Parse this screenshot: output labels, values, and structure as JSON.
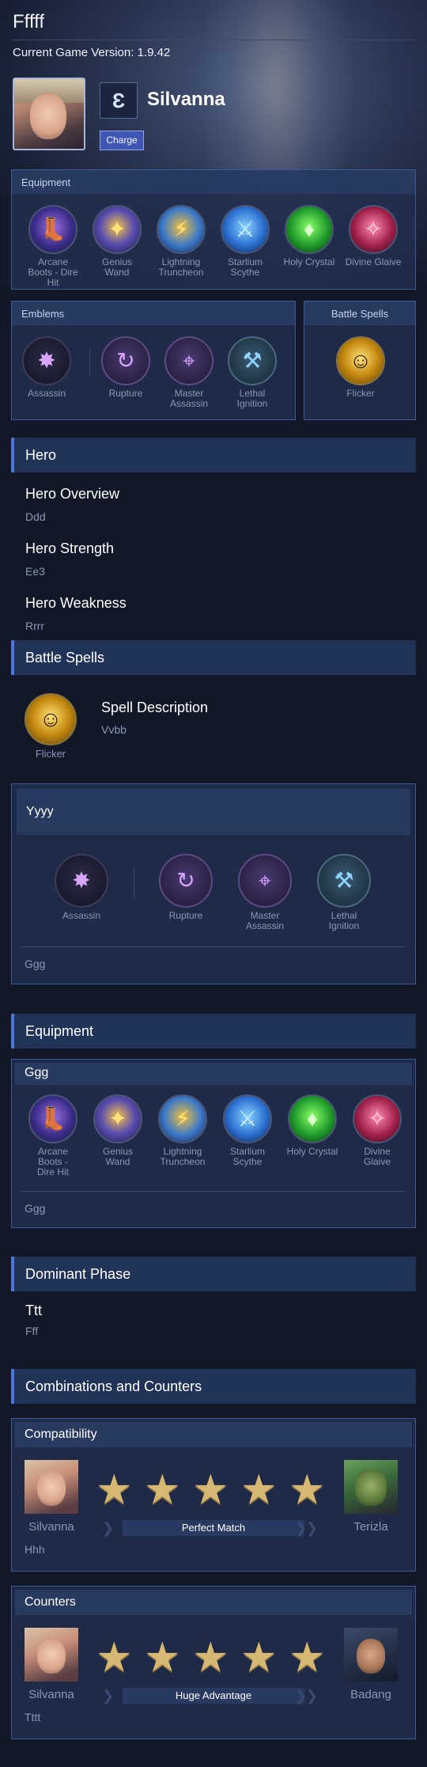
{
  "page": {
    "title": "Fffff",
    "version": "Current Game Version: 1.9.42"
  },
  "hero": {
    "name": "Silvanna",
    "role_badge": "Charge",
    "role_icon": "charge-role-icon"
  },
  "build": {
    "equipment": {
      "header": "Equipment",
      "items": [
        {
          "label": "Arcane Boots - Dire Hit",
          "icon": "arcane-boots-icon"
        },
        {
          "label": "Genius Wand",
          "icon": "genius-wand-icon"
        },
        {
          "label": "Lightning Truncheon",
          "icon": "lightning-truncheon-icon"
        },
        {
          "label": "Starlium Scythe",
          "icon": "starlium-scythe-icon"
        },
        {
          "label": "Holy Crystal",
          "icon": "holy-crystal-icon"
        },
        {
          "label": "Divine Glaive",
          "icon": "divine-glaive-icon"
        }
      ]
    },
    "emblems": {
      "header": "Emblems",
      "items": [
        {
          "label": "Assassin",
          "icon": "assassin-emblem-icon"
        },
        {
          "label": "Rupture",
          "icon": "rupture-talent-icon"
        },
        {
          "label": "Master Assassin",
          "icon": "master-assassin-talent-icon"
        },
        {
          "label": "Lethal Ignition",
          "icon": "lethal-ignition-talent-icon"
        }
      ]
    },
    "battle_spells": {
      "header": "Battle Spells",
      "items": [
        {
          "label": "Flicker",
          "icon": "flicker-spell-icon"
        }
      ]
    }
  },
  "hero_section": {
    "header": "Hero",
    "overview_title": "Hero Overview",
    "overview_text": "Ddd",
    "strength_title": "Hero Strength",
    "strength_text": "Ee3",
    "weakness_title": "Hero Weakness",
    "weakness_text": "Rrrr"
  },
  "spells_section": {
    "header": "Battle Spells",
    "spell_label": "Flicker",
    "description_title": "Spell Description",
    "description_text": "Vvbb"
  },
  "emblem_section": {
    "header": "Yyyy",
    "items": [
      {
        "label": "Assassin"
      },
      {
        "label": "Rupture"
      },
      {
        "label": "Master Assassin"
      },
      {
        "label": "Lethal Ignition"
      }
    ],
    "note": "Ggg"
  },
  "equipment_section": {
    "header": "Equipment",
    "build_title": "Ggg",
    "items": [
      {
        "label": "Arcane Boots - Dire Hit"
      },
      {
        "label": "Genius Wand"
      },
      {
        "label": "Lightning Truncheon"
      },
      {
        "label": "Starlium Scythe"
      },
      {
        "label": "Holy Crystal"
      },
      {
        "label": "Divine Glaive"
      }
    ],
    "note": "Ggg"
  },
  "dominant_phase": {
    "header": "Dominant Phase",
    "title": "Ttt",
    "text": "Fff"
  },
  "combinations": {
    "header": "Combinations and Counters",
    "compatibility": {
      "header": "Compatibility",
      "hero_left": "Silvanna",
      "hero_right": "Terizla",
      "stars": 5,
      "rating_label": "Perfect Match",
      "note": "Hhh"
    },
    "counters": {
      "header": "Counters",
      "hero_left": "Silvanna",
      "hero_right": "Badang",
      "stars": 5,
      "rating_label": "Huge Advantage",
      "note": "Tttt"
    }
  },
  "colors": {
    "background": "#121828",
    "accent": "#4f78d6",
    "star": "#d7b873",
    "panel_border": "#3e5a96"
  }
}
